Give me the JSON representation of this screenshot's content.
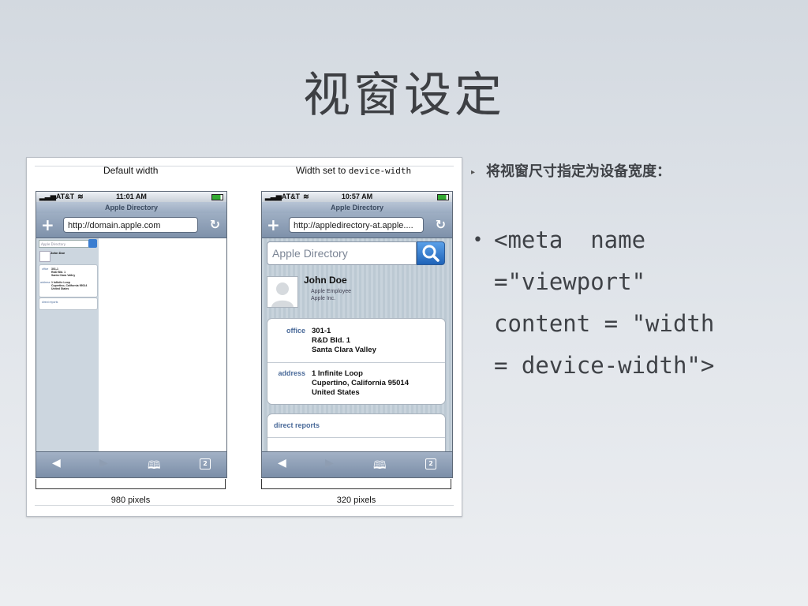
{
  "slide": {
    "title": "视窗设定",
    "sub_bullet": "将视窗尺寸指定为设备宽度：",
    "code_lines": [
      "<meta  name",
      "=\"viewport\"",
      "content = \"width",
      "= device-width\">"
    ]
  },
  "figure": {
    "left_caption": "Default width",
    "right_caption_prefix": "Width set to ",
    "right_caption_code": "device-width",
    "left_pixels": "980 pixels",
    "right_pixels": "320 pixels"
  },
  "left_phone": {
    "carrier": "AT&T",
    "time": "11:01 AM",
    "page_title": "Apple Directory",
    "url": "http://domain.apple.com",
    "mini": {
      "search": "Apple Directory",
      "name": "John Doe",
      "office_label": "office",
      "office_lines": [
        "301-1",
        "R&D Bld. 1",
        "Santa Clara Valley"
      ],
      "address_label": "address",
      "address_lines": [
        "1 Infinite Loop",
        "Cupertino, California 95014",
        "United States"
      ],
      "reports": "direct reports"
    }
  },
  "right_phone": {
    "carrier": "AT&T",
    "time": "10:57 AM",
    "page_title": "Apple Directory",
    "url": "http://appledirectory-at.apple....",
    "search_placeholder": "Apple Directory",
    "person": {
      "name": "John Doe",
      "role": "Apple Employee",
      "company": "Apple Inc."
    },
    "office_label": "office",
    "office_lines": [
      "301-1",
      "R&D Bld. 1",
      "Santa Clara Valley"
    ],
    "address_label": "address",
    "address_lines": [
      "1 Infinite Loop",
      "Cupertino, California 95014",
      "United States"
    ],
    "direct_reports": "direct reports",
    "pages_count": "2"
  },
  "icons": {
    "signal": "signal-bars-icon",
    "wifi": "wifi-icon",
    "battery": "battery-icon",
    "add": "plus-icon",
    "reload": "reload-icon",
    "back": "back-arrow-icon",
    "forward": "forward-arrow-icon",
    "bookmarks": "bookmarks-icon",
    "pages": "pages-icon",
    "search": "magnifier-icon"
  },
  "colors": {
    "safari_bar": "#8597b0",
    "link_label": "#4a6a99",
    "search_button": "#2f77cf"
  }
}
